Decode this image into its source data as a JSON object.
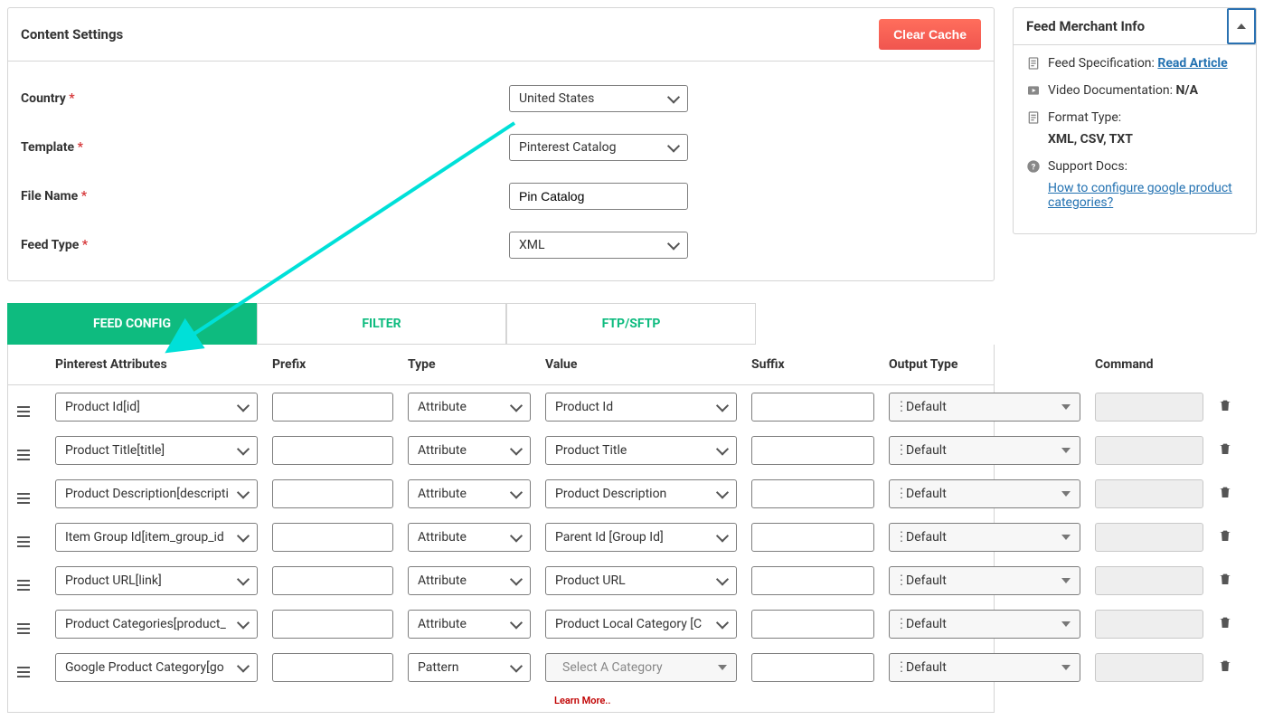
{
  "content_settings": {
    "title": "Content Settings",
    "clear_cache": "Clear Cache",
    "country_label": "Country",
    "country_value": "United States",
    "template_label": "Template",
    "template_value": "Pinterest Catalog",
    "filename_label": "File Name",
    "filename_value": "Pin Catalog",
    "feedtype_label": "Feed Type",
    "feedtype_value": "XML"
  },
  "tabs": {
    "feed_config": "FEED CONFIG",
    "filter": "FILTER",
    "ftp": "FTP/SFTP"
  },
  "headers": {
    "attr": "Pinterest Attributes",
    "prefix": "Prefix",
    "type": "Type",
    "value": "Value",
    "suffix": "Suffix",
    "output": "Output Type",
    "cmd": "Command"
  },
  "rows": [
    {
      "attr": "Product Id[id]",
      "type": "Attribute",
      "value": "Product Id",
      "output": "Default",
      "value_placeholder": false
    },
    {
      "attr": "Product Title[title]",
      "type": "Attribute",
      "value": "Product Title",
      "output": "Default",
      "value_placeholder": false
    },
    {
      "attr": "Product Description[descripti",
      "type": "Attribute",
      "value": "Product Description",
      "output": "Default",
      "value_placeholder": false
    },
    {
      "attr": "Item Group Id[item_group_id",
      "type": "Attribute",
      "value": "Parent Id [Group Id]",
      "output": "Default",
      "value_placeholder": false
    },
    {
      "attr": "Product URL[link]",
      "type": "Attribute",
      "value": "Product URL",
      "output": "Default",
      "value_placeholder": false
    },
    {
      "attr": "Product Categories[product_",
      "type": "Attribute",
      "value": "Product Local Category [C",
      "output": "Default",
      "value_placeholder": false
    },
    {
      "attr": "Google Product Category[go",
      "type": "Pattern",
      "value": "Select A Category",
      "output": "Default",
      "value_placeholder": true
    }
  ],
  "learn_more": "Learn More..",
  "sidebar": {
    "title": "Feed Merchant Info",
    "spec_label": "Feed Specification: ",
    "spec_link": "Read Article",
    "video_label": "Video Documentation: ",
    "video_value": "N/A",
    "format_label": "Format Type:",
    "format_value": "XML, CSV, TXT",
    "support_label": "Support Docs:",
    "support_link": "How to configure google product categories?"
  }
}
